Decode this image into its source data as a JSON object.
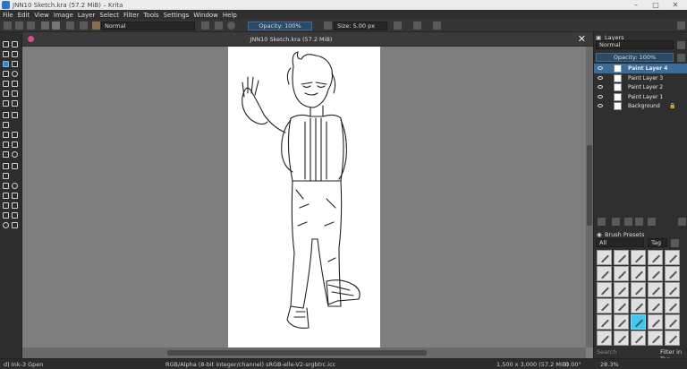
{
  "window": {
    "title": "JNN10 Sketch.kra (57.2 MiB) – Krita",
    "min": "–",
    "max": "□",
    "close": "✕"
  },
  "menu": [
    "File",
    "Edit",
    "View",
    "Image",
    "Layer",
    "Select",
    "Filter",
    "Tools",
    "Settings",
    "Window",
    "Help"
  ],
  "toolbar": {
    "blend_mode": "Normal",
    "opacity": "Opacity: 100%",
    "size": "Size: 5.00 px"
  },
  "document": {
    "tab_title": "JNN10 Sketch.kra (57.2 MiB)",
    "close_label": "✕"
  },
  "layers": {
    "title": "Layers",
    "blend_mode": "Normal",
    "opacity": "Opacity:  100%",
    "items": [
      {
        "name": "Paint Layer 4",
        "selected": true
      },
      {
        "name": "Paint Layer 3"
      },
      {
        "name": "Paint Layer 2"
      },
      {
        "name": "Paint Layer 1"
      },
      {
        "name": "Background",
        "locked": true
      }
    ]
  },
  "brush_presets": {
    "title": "Brush Presets",
    "filter": "All",
    "tag_label": "Tag",
    "search_placeholder": "Search",
    "filter_in_tag": "Filter in Tag"
  },
  "status": {
    "brush": "d) Ink-3 Gpen",
    "color_profile": "RGB/Alpha (8-bit integer/channel)  sRGB-elle-V2-srgbtrc.icc",
    "dimensions": "1,500 x 3,000 (57.2 MiB)",
    "rotation": "0.00°",
    "zoom": "28.3%"
  },
  "colors": {
    "accent": "#3d82c4",
    "selected_layer": "#3a6c9a",
    "selected_brush": "#3fc9f0",
    "canvas_bg": "#7e7e7e",
    "panel_bg": "#2f2f2f"
  }
}
